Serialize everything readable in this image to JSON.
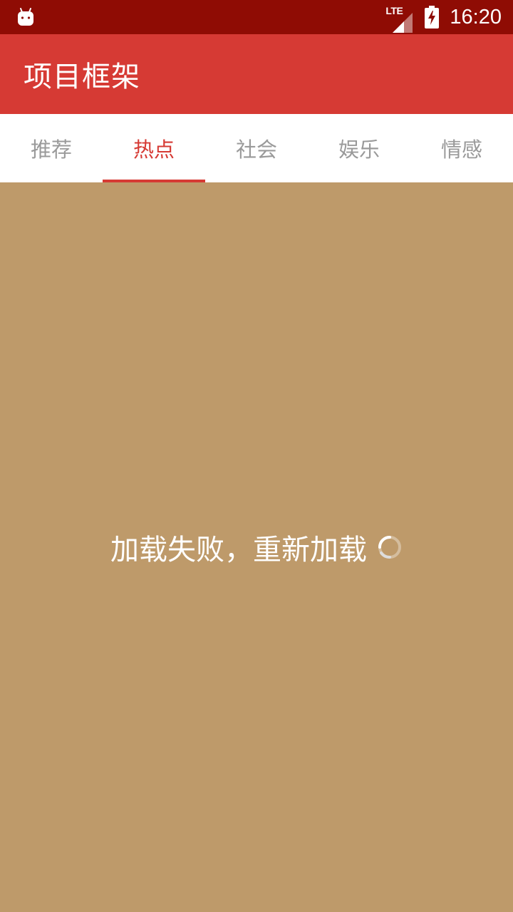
{
  "status_bar": {
    "network_label": "LTE",
    "time": "16:20",
    "notification_icon": "android-debug-icon",
    "signal_icon": "cell-signal-icon",
    "battery_icon": "battery-charging-icon"
  },
  "app_bar": {
    "title": "项目框架"
  },
  "tabs": [
    {
      "label": "推荐",
      "active": false
    },
    {
      "label": "热点",
      "active": true
    },
    {
      "label": "社会",
      "active": false
    },
    {
      "label": "娱乐",
      "active": false
    },
    {
      "label": "情感",
      "active": false
    }
  ],
  "content": {
    "reload_message": "加载失败，重新加载",
    "loading_icon": "loading-spinner-icon"
  },
  "colors": {
    "status_bar": "#8f0c04",
    "app_bar": "#d63a34",
    "accent": "#d63a34",
    "tab_inactive": "#9a9a9a",
    "content_background": "#be9a6a",
    "tab_background": "#ffffff"
  }
}
